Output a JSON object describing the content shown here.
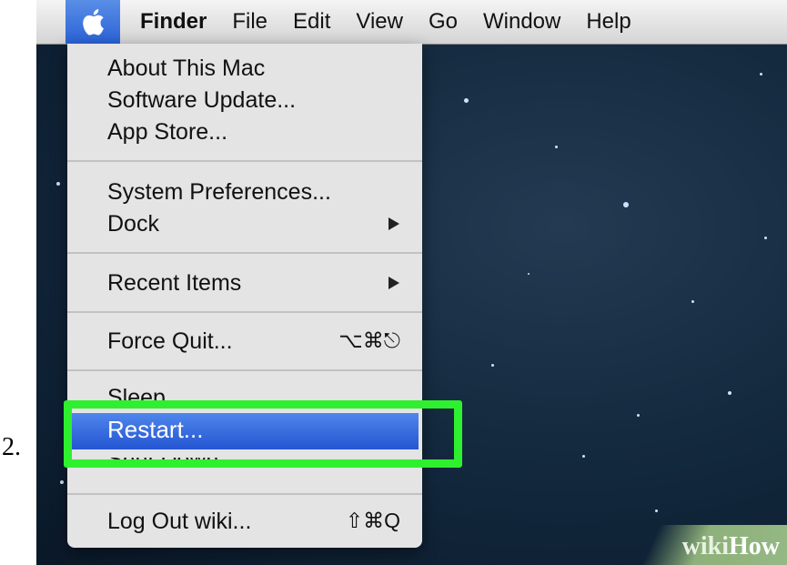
{
  "step_number": "2.",
  "menu_bar": {
    "apple_icon": "apple-logo-icon",
    "items": [
      "Finder",
      "File",
      "Edit",
      "View",
      "Go",
      "Window",
      "Help"
    ]
  },
  "apple_menu": {
    "groups": [
      [
        {
          "label": "About This Mac"
        },
        {
          "label": "Software Update..."
        },
        {
          "label": "App Store..."
        }
      ],
      [
        {
          "label": "System Preferences..."
        },
        {
          "label": "Dock",
          "submenu_icon": "triangle-right-icon"
        }
      ],
      [
        {
          "label": "Recent Items",
          "submenu_icon": "triangle-right-icon"
        }
      ],
      [
        {
          "label": "Force Quit...",
          "shortcut": "⌥⌘⎋"
        }
      ],
      [
        {
          "label": "Sleep"
        },
        {
          "label": "Restart...",
          "highlighted": true
        },
        {
          "label": "Shut Down..."
        }
      ],
      [
        {
          "label": "Log Out wiki...",
          "shortcut": "⇧⌘Q"
        }
      ]
    ]
  },
  "annotation": {
    "highlight_color": "#2ef02e",
    "target": "Restart..."
  },
  "watermark": {
    "prefix": "wiki",
    "suffix": "How"
  },
  "colors": {
    "selection": "#2f62d8",
    "menu_bg": "#e4e4e4",
    "desktop": "#142a3f"
  }
}
